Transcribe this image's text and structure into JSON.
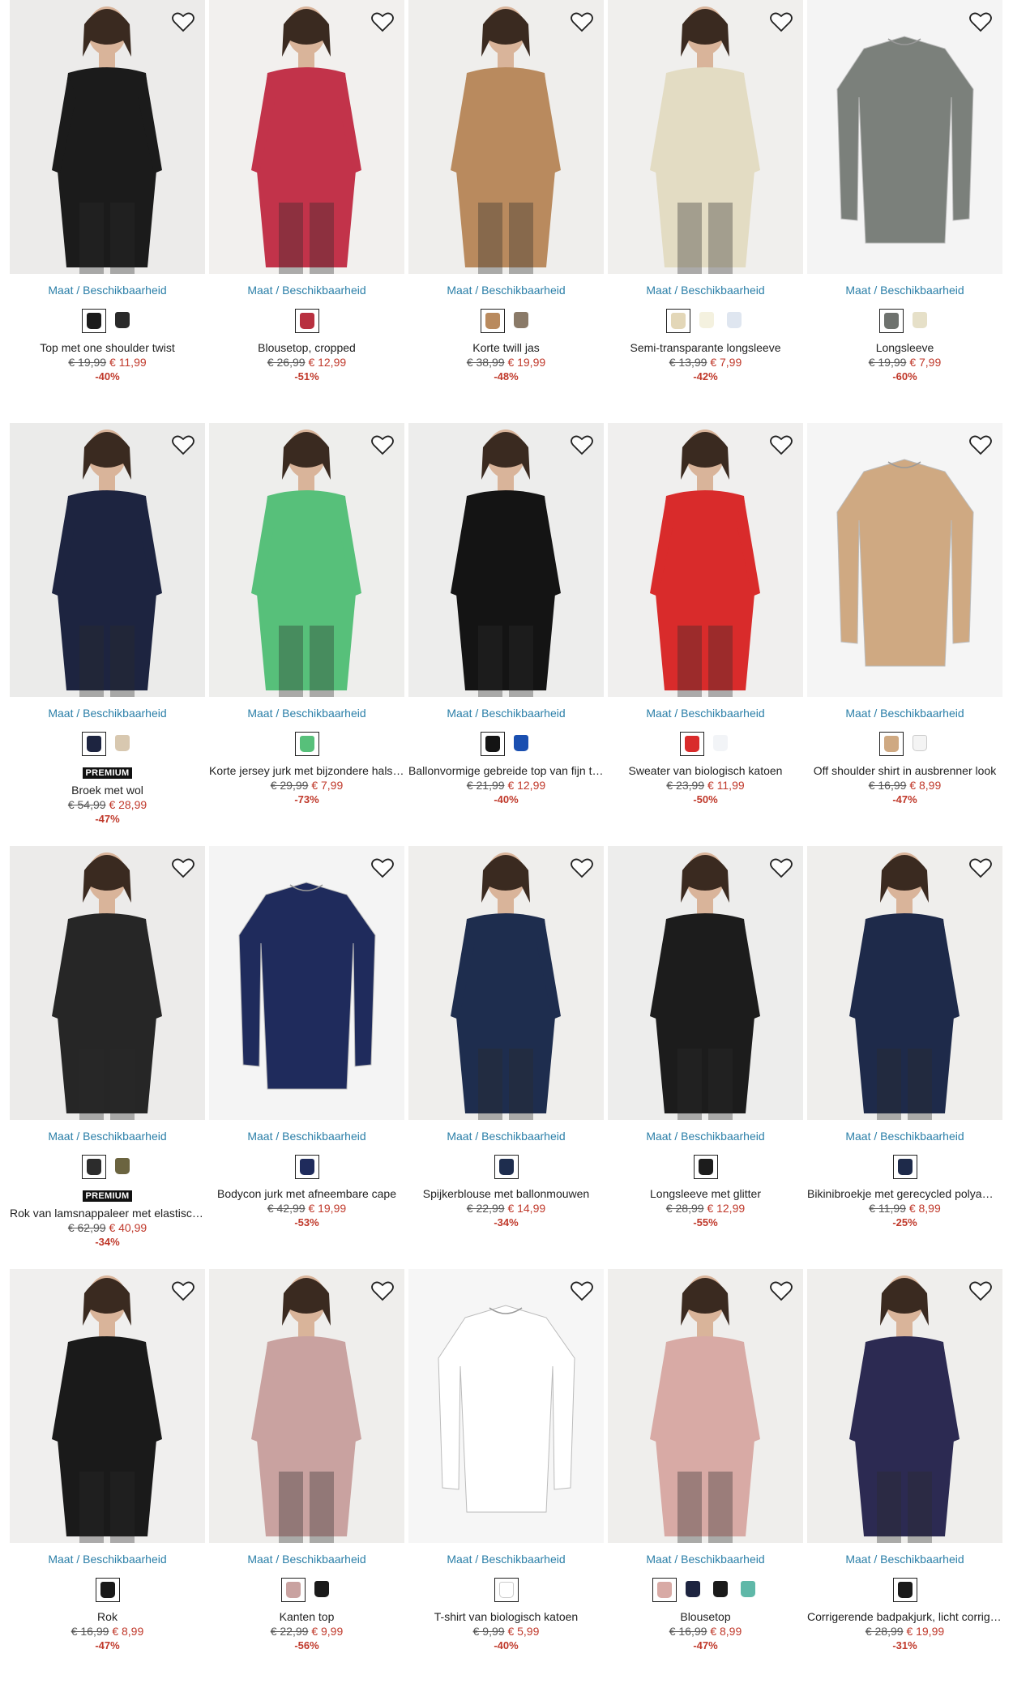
{
  "size_link_label": "Maat / Beschikbaarheid",
  "premium_label": "PREMIUM",
  "colors": {
    "link": "#2b7fa8",
    "sale": "#c0392b"
  },
  "products": [
    {
      "name": "Top met one shoulder twist",
      "old_price": "€ 19,99",
      "new_price": "€ 11,99",
      "discount": "-40%",
      "premium": false,
      "image": "black-one-shoulder-top",
      "bg": "#ecebea",
      "garment": "#1b1b1b",
      "swatches": [
        "#1b1b1b",
        "#2a2a2a"
      ]
    },
    {
      "name": "Blousetop, cropped",
      "old_price": "€ 26,99",
      "new_price": "€ 12,99",
      "discount": "-51%",
      "premium": false,
      "image": "floral-cropped-blouse",
      "bg": "#f2f0ee",
      "garment": "#c2334a",
      "swatches": [
        "#b8303f"
      ]
    },
    {
      "name": "Korte twill jas",
      "old_price": "€ 38,99",
      "new_price": "€ 19,99",
      "discount": "-48%",
      "premium": false,
      "image": "camel-twill-jacket",
      "bg": "#efeeec",
      "garment": "#b98a5e",
      "swatches": [
        "#b98a5e",
        "#8a7a68"
      ]
    },
    {
      "name": "Semi-transparante longsleeve",
      "old_price": "€ 13,99",
      "new_price": "€ 7,99",
      "discount": "-42%",
      "premium": false,
      "image": "beige-longsleeve",
      "bg": "#f0efed",
      "garment": "#e3dcc3",
      "swatches": [
        "#e3d7b8",
        "#f4f1df",
        "#dfe6f0"
      ]
    },
    {
      "name": "Longsleeve",
      "old_price": "€ 19,99",
      "new_price": "€ 7,99",
      "discount": "-60%",
      "premium": false,
      "image": "grey-ruched-longsleeve",
      "bg": "#f4f4f4",
      "garment": "#7b807b",
      "swatches": [
        "#6e726e",
        "#e6e0c8"
      ]
    },
    {
      "name": "Broek met wol",
      "old_price": "€ 54,99",
      "new_price": "€ 28,99",
      "discount": "-47%",
      "premium": true,
      "image": "navy-trousers",
      "bg": "#ebebea",
      "garment": "#1d2440",
      "swatches": [
        "#1d2440",
        "#d8c8b0"
      ]
    },
    {
      "name": "Korte jersey jurk met bijzondere halslijn",
      "old_price": "€ 29,99",
      "new_price": "€ 7,99",
      "discount": "-73%",
      "premium": false,
      "image": "green-jersey-dress",
      "bg": "#eeeeec",
      "garment": "#57c07a",
      "swatches": [
        "#57c07a"
      ]
    },
    {
      "name": "Ballonvormige gebreide top van fijn tricot",
      "old_price": "€ 21,99",
      "new_price": "€ 12,99",
      "discount": "-40%",
      "premium": false,
      "image": "black-knit-top",
      "bg": "#ededec",
      "garment": "#141414",
      "swatches": [
        "#141414",
        "#1a4fb0"
      ]
    },
    {
      "name": "Sweater van biologisch katoen",
      "old_price": "€ 23,99",
      "new_price": "€ 11,99",
      "discount": "-50%",
      "premium": false,
      "image": "red-sweater",
      "bg": "#f0efee",
      "garment": "#d92b2b",
      "swatches": [
        "#d92b2b",
        "#f2f4f7"
      ]
    },
    {
      "name": "Off shoulder shirt in ausbrenner look",
      "old_price": "€ 16,99",
      "new_price": "€ 8,99",
      "discount": "-47%",
      "premium": false,
      "image": "beige-off-shoulder-shirt",
      "bg": "#f5f5f5",
      "garment": "#cfa982",
      "swatches": [
        "#cfa982",
        "#f4f4f4"
      ]
    },
    {
      "name": "Rok van lamsnappaleer met elastische band",
      "old_price": "€ 62,99",
      "new_price": "€ 40,99",
      "discount": "-34%",
      "premium": true,
      "image": "leather-skirt",
      "bg": "#ecebea",
      "garment": "#262626",
      "swatches": [
        "#2c2c2c",
        "#6b6440"
      ]
    },
    {
      "name": "Bodycon jurk met afneembare cape",
      "old_price": "€ 42,99",
      "new_price": "€ 19,99",
      "discount": "-53%",
      "premium": false,
      "image": "navy-cape-dress",
      "bg": "#f4f4f4",
      "garment": "#1f2b5c",
      "swatches": [
        "#1f2b5c"
      ]
    },
    {
      "name": "Spijkerblouse met ballonmouwen",
      "old_price": "€ 22,99",
      "new_price": "€ 14,99",
      "discount": "-34%",
      "premium": false,
      "image": "denim-blouse",
      "bg": "#efeeec",
      "garment": "#1e2d4e",
      "swatches": [
        "#1e2d4e"
      ]
    },
    {
      "name": "Longsleeve met glitter",
      "old_price": "€ 28,99",
      "new_price": "€ 12,99",
      "discount": "-55%",
      "premium": false,
      "image": "black-glitter-longsleeve",
      "bg": "#ededec",
      "garment": "#1c1c1c",
      "swatches": [
        "#1c1c1c"
      ]
    },
    {
      "name": "Bikinibroekje met gerecycled polyamide",
      "old_price": "€ 11,99",
      "new_price": "€ 8,99",
      "discount": "-25%",
      "premium": false,
      "image": "floral-swimsuit",
      "bg": "#efeeec",
      "garment": "#1e2a4a",
      "swatches": [
        "#1e2a4a"
      ]
    },
    {
      "name": "Rok",
      "old_price": "€ 16,99",
      "new_price": "€ 8,99",
      "discount": "-47%",
      "premium": false,
      "image": "black-mini-skirt",
      "bg": "#f0efee",
      "garment": "#1a1a1a",
      "swatches": [
        "#1a1a1a"
      ]
    },
    {
      "name": "Kanten top",
      "old_price": "€ 22,99",
      "new_price": "€ 9,99",
      "discount": "-56%",
      "premium": false,
      "image": "pink-lace-top",
      "bg": "#efeeec",
      "garment": "#c9a2a0",
      "swatches": [
        "#c9a2a0",
        "#1a1a1a"
      ]
    },
    {
      "name": "T-shirt van biologisch katoen",
      "old_price": "€ 9,99",
      "new_price": "€ 5,99",
      "discount": "-40%",
      "premium": false,
      "image": "white-tshirt",
      "bg": "#f6f6f6",
      "garment": "#ffffff",
      "swatches": [
        "#ffffff"
      ]
    },
    {
      "name": "Blousetop",
      "old_price": "€ 16,99",
      "new_price": "€ 8,99",
      "discount": "-47%",
      "premium": false,
      "image": "rose-blousetop",
      "bg": "#efeeec",
      "garment": "#d8aaa5",
      "swatches": [
        "#d8aaa5",
        "#1d2440",
        "#1a1a1a",
        "#5fb8a8"
      ]
    },
    {
      "name": "Corrigerende badpakjurk, licht corrigerend",
      "old_price": "€ 28,99",
      "new_price": "€ 19,99",
      "discount": "-31%",
      "premium": false,
      "image": "floral-swimdress",
      "bg": "#efeeec",
      "garment": "#2c2a52",
      "swatches": [
        "#1a1a1a"
      ]
    }
  ]
}
